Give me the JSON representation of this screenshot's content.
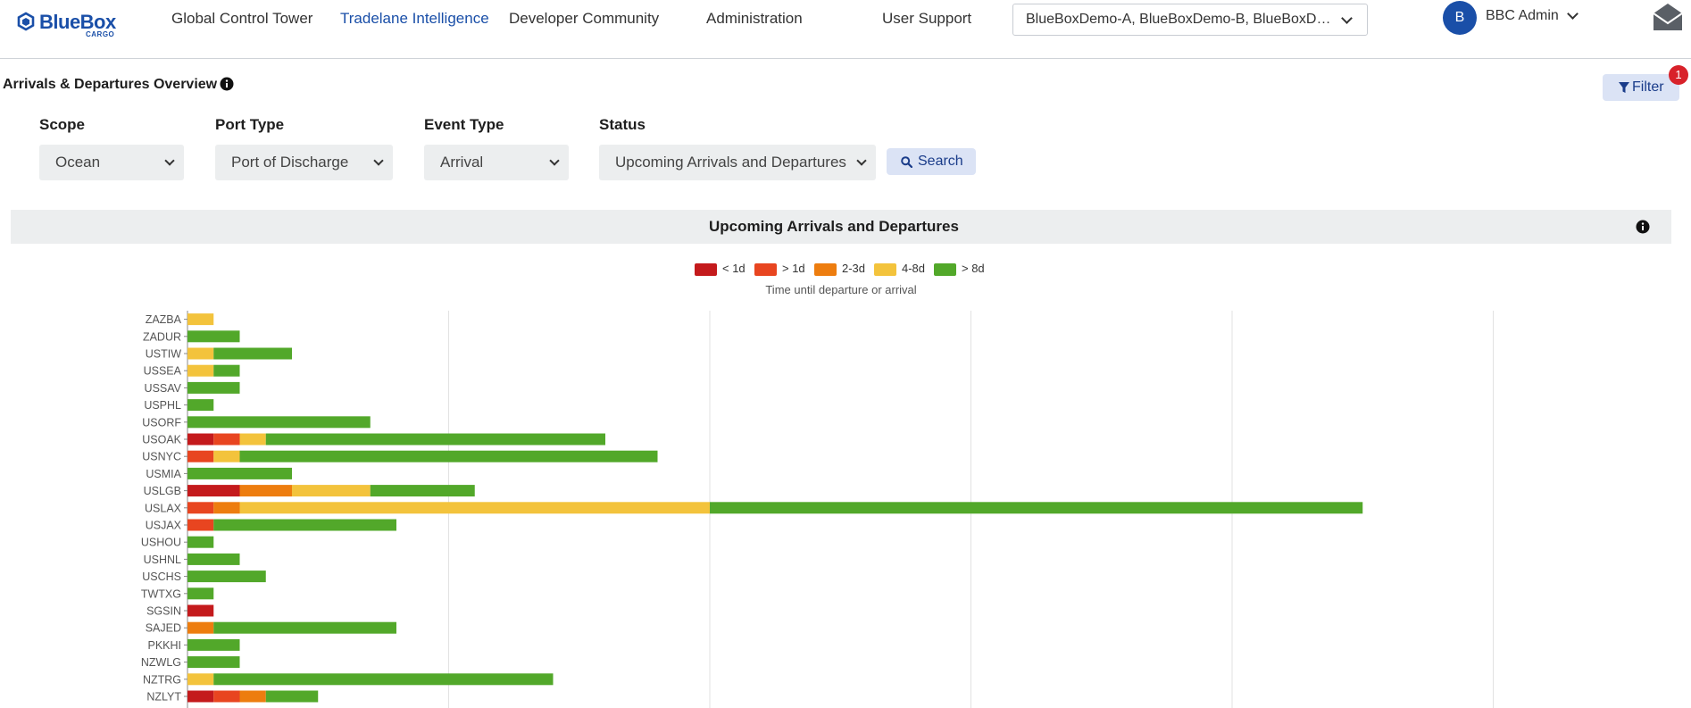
{
  "header": {
    "logo": {
      "brand": "BlueBox",
      "sub": "CARGO"
    },
    "nav": [
      {
        "label": "Global Control Tower",
        "active": false
      },
      {
        "label": "Tradelane Intelligence",
        "active": true
      },
      {
        "label": "Developer Community",
        "active": false
      },
      {
        "label": "Administration",
        "active": false
      },
      {
        "label": "User Support",
        "active": false
      }
    ],
    "company_select": "BlueBoxDemo-A, BlueBoxDemo-B, BlueBoxDemo-C",
    "user": {
      "initial": "B",
      "name": "BBC Admin"
    }
  },
  "page": {
    "title": "Arrivals & Departures Overview",
    "filter_button": "Filter",
    "filter_count": "1"
  },
  "filters": {
    "scope": {
      "label": "Scope",
      "value": "Ocean"
    },
    "port_type": {
      "label": "Port Type",
      "value": "Port of Discharge"
    },
    "event_type": {
      "label": "Event Type",
      "value": "Arrival"
    },
    "status": {
      "label": "Status",
      "value": "Upcoming Arrivals and Departures"
    },
    "search_button": "Search"
  },
  "chart_panel": {
    "title": "Upcoming Arrivals and Departures",
    "legend_caption": "Time until departure or arrival"
  },
  "colors": {
    "lt1d": "#c41a1c",
    "gt1d": "#e84520",
    "d2_3": "#ed7d0f",
    "d4_8": "#f3c33c",
    "gt8d": "#52a82a",
    "brand": "#1a4fa8"
  },
  "chart_data": {
    "type": "bar",
    "orientation": "horizontal",
    "stacked": true,
    "categories": [
      "ZAZBA",
      "ZADUR",
      "USTIW",
      "USSEA",
      "USSAV",
      "USPHL",
      "USORF",
      "USOAK",
      "USNYC",
      "USMIA",
      "USLGB",
      "USLAX",
      "USJAX",
      "USHOU",
      "USHNL",
      "USCHS",
      "TWTXG",
      "SGSIN",
      "SAJED",
      "PKKHI",
      "NZWLG",
      "NZTRG",
      "NZLYT"
    ],
    "series": [
      {
        "name": "< 1d",
        "color": "#c41a1c",
        "values": [
          0,
          0,
          0,
          0,
          0,
          0,
          0,
          1,
          0,
          0,
          2,
          0,
          0,
          0,
          0,
          0,
          0,
          1,
          0,
          0,
          0,
          0,
          1
        ]
      },
      {
        "name": "> 1d",
        "color": "#e84520",
        "values": [
          0,
          0,
          0,
          0,
          0,
          0,
          0,
          1,
          1,
          0,
          0,
          1,
          1,
          0,
          0,
          0,
          0,
          0,
          0,
          0,
          0,
          0,
          1
        ]
      },
      {
        "name": "2-3d",
        "color": "#ed7d0f",
        "values": [
          0,
          0,
          0,
          0,
          0,
          0,
          0,
          0,
          0,
          0,
          2,
          1,
          0,
          0,
          0,
          0,
          0,
          0,
          1,
          0,
          0,
          0,
          1
        ]
      },
      {
        "name": "4-8d",
        "color": "#f3c33c",
        "values": [
          1,
          0,
          1,
          1,
          0,
          0,
          0,
          1,
          1,
          0,
          3,
          18,
          0,
          0,
          0,
          0,
          0,
          0,
          0,
          0,
          0,
          1,
          0
        ]
      },
      {
        "name": "> 8d",
        "color": "#52a82a",
        "values": [
          0,
          2,
          3,
          1,
          2,
          1,
          7,
          13,
          16,
          4,
          4,
          25,
          7,
          1,
          2,
          3,
          1,
          0,
          7,
          2,
          2,
          13,
          2
        ]
      }
    ],
    "xlim": [
      0,
      50
    ],
    "x_gridlines": [
      10,
      20,
      30,
      40,
      50
    ],
    "grid": true,
    "legend_position": "top-center"
  }
}
